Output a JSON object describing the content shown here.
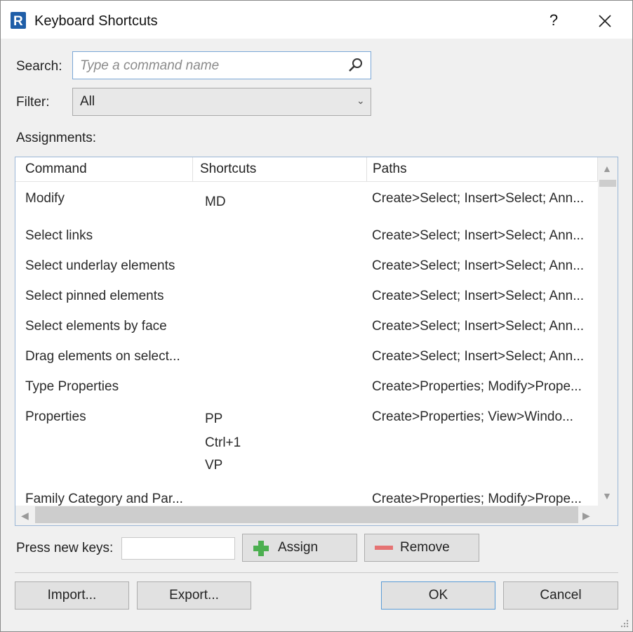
{
  "window": {
    "title": "Keyboard Shortcuts",
    "help": "?",
    "icons": {
      "app": "revit-logo-icon",
      "close": "close-icon",
      "search": "search-icon"
    }
  },
  "search": {
    "label": "Search:",
    "placeholder": "Type a command name",
    "value": ""
  },
  "filter": {
    "label": "Filter:",
    "value": "All"
  },
  "assignments": {
    "label": "Assignments:",
    "columns": [
      "Command",
      "Shortcuts",
      "Paths"
    ],
    "rows": [
      {
        "command": "Modify",
        "shortcuts": [
          "MD"
        ],
        "paths": "Create>Select; Insert>Select; Ann..."
      },
      {
        "command": "Select links",
        "shortcuts": [],
        "paths": "Create>Select; Insert>Select; Ann..."
      },
      {
        "command": "Select underlay elements",
        "shortcuts": [],
        "paths": "Create>Select; Insert>Select; Ann..."
      },
      {
        "command": "Select pinned elements",
        "shortcuts": [],
        "paths": "Create>Select; Insert>Select; Ann..."
      },
      {
        "command": "Select elements by face",
        "shortcuts": [],
        "paths": "Create>Select; Insert>Select; Ann..."
      },
      {
        "command": "Drag elements on select...",
        "shortcuts": [],
        "paths": "Create>Select; Insert>Select; Ann..."
      },
      {
        "command": "Type Properties",
        "shortcuts": [],
        "paths": "Create>Properties; Modify>Prope..."
      },
      {
        "command": "Properties",
        "shortcuts": [
          "PP",
          "Ctrl+1",
          "VP"
        ],
        "paths": "Create>Properties; View>Windo..."
      },
      {
        "command": "Family Category and Par...",
        "shortcuts": [],
        "paths": "Create>Properties; Modify>Prope..."
      }
    ]
  },
  "keys": {
    "label": "Press new keys:",
    "value": ""
  },
  "buttons": {
    "assign": "Assign",
    "remove": "Remove",
    "import": "Import...",
    "export": "Export...",
    "ok": "OK",
    "cancel": "Cancel"
  },
  "colors": {
    "accent": "#5b9bd5",
    "assign_plus": "#4caf50",
    "remove_minus": "#e57373",
    "logo": "#1f5ea8"
  }
}
